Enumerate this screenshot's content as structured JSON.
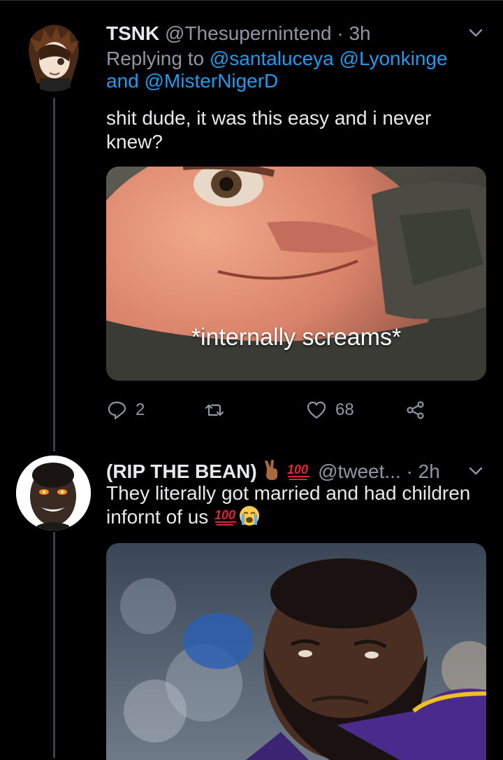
{
  "tweets": [
    {
      "display_name": "TSNK",
      "handle": "@Thesupernintend",
      "separator": "·",
      "time": "3h",
      "reply_prefix": "Replying to",
      "reply_mentions": [
        "@santaluceya",
        "@Lyonkinge",
        "@MisterNigerD"
      ],
      "reply_and": "and",
      "text": "shit dude, it was this easy and i never knew?",
      "media_caption": "*internally screams*",
      "stats": {
        "replies": "2",
        "retweets": "",
        "likes": "68"
      }
    },
    {
      "display_name": "(RIP THE BEAN)",
      "handle": "@tweet...",
      "separator": "·",
      "time": "2h",
      "text": "They literally got married and had children infornt of us",
      "emoji_names": [
        "victory-hand-emoji",
        "hundred-points-emoji",
        "crying-face-emoji"
      ]
    }
  ],
  "colors": {
    "background": "#000000",
    "primary_text": "#e7e9ea",
    "secondary_text": "#8b98a5",
    "accent": "#1d9bf0",
    "thread_line": "#3d4145"
  }
}
